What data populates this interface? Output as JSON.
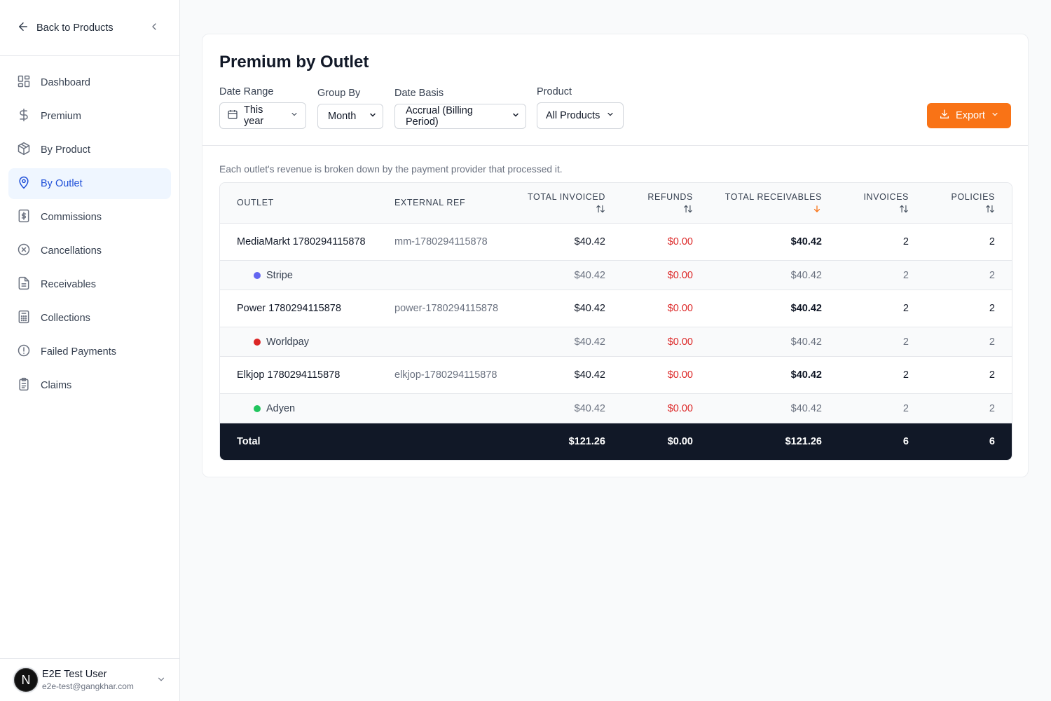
{
  "sidebar": {
    "back_label": "Back to Products",
    "items": [
      {
        "label": "Dashboard",
        "icon": "dashboard-icon",
        "active": false
      },
      {
        "label": "Premium",
        "icon": "dollar-icon",
        "active": false
      },
      {
        "label": "By Product",
        "icon": "package-icon",
        "active": false
      },
      {
        "label": "By Outlet",
        "icon": "map-pin-icon",
        "active": true
      },
      {
        "label": "Commissions",
        "icon": "receipt-dollar-icon",
        "active": false
      },
      {
        "label": "Cancellations",
        "icon": "x-circle-icon",
        "active": false
      },
      {
        "label": "Receivables",
        "icon": "document-icon",
        "active": false
      },
      {
        "label": "Collections",
        "icon": "calculator-icon",
        "active": false
      },
      {
        "label": "Failed Payments",
        "icon": "alert-circle-icon",
        "active": false
      },
      {
        "label": "Claims",
        "icon": "clipboard-icon",
        "active": false
      }
    ],
    "user": {
      "initial": "N",
      "name": "E2E Test User",
      "email": "e2e-test@gangkhar.com"
    }
  },
  "header": {
    "title": "Premium by Outlet",
    "filters": {
      "date_range": {
        "label": "Date Range",
        "value": "This year"
      },
      "group_by": {
        "label": "Group By",
        "value": "Month"
      },
      "date_basis": {
        "label": "Date Basis",
        "value": "Accrual (Billing Period)"
      },
      "product": {
        "label": "Product",
        "value": "All Products"
      }
    },
    "export_label": "Export"
  },
  "description": "Each outlet's revenue is broken down by the payment provider that processed it.",
  "table": {
    "columns": {
      "outlet": "Outlet",
      "external_ref": "External Ref",
      "total_invoiced": "Total Invoiced",
      "refunds": "Refunds",
      "total_receivables": "Total Receivables",
      "invoices": "Invoices",
      "policies": "Policies"
    },
    "sorted_column": "total_receivables",
    "rows": [
      {
        "outlet": "MediaMarkt 1780294115878",
        "ref": "mm-1780294115878",
        "invoiced": "$40.42",
        "refunds": "$0.00",
        "receivables": "$40.42",
        "invoices": "2",
        "policies": "2",
        "provider": {
          "name": "Stripe",
          "color": "#6366f1",
          "invoiced": "$40.42",
          "refunds": "$0.00",
          "receivables": "$40.42",
          "invoices": "2",
          "policies": "2"
        }
      },
      {
        "outlet": "Power 1780294115878",
        "ref": "power-1780294115878",
        "invoiced": "$40.42",
        "refunds": "$0.00",
        "receivables": "$40.42",
        "invoices": "2",
        "policies": "2",
        "provider": {
          "name": "Worldpay",
          "color": "#dc2626",
          "invoiced": "$40.42",
          "refunds": "$0.00",
          "receivables": "$40.42",
          "invoices": "2",
          "policies": "2"
        }
      },
      {
        "outlet": "Elkjop 1780294115878",
        "ref": "elkjop-1780294115878",
        "invoiced": "$40.42",
        "refunds": "$0.00",
        "receivables": "$40.42",
        "invoices": "2",
        "policies": "2",
        "provider": {
          "name": "Adyen",
          "color": "#22c55e",
          "invoiced": "$40.42",
          "refunds": "$0.00",
          "receivables": "$40.42",
          "invoices": "2",
          "policies": "2"
        }
      }
    ],
    "total": {
      "label": "Total",
      "invoiced": "$121.26",
      "refunds": "$0.00",
      "receivables": "$121.26",
      "invoices": "6",
      "policies": "6"
    }
  },
  "colors": {
    "accent": "#f97316",
    "active_nav": "#1d4ed8",
    "refund_red": "#dc2626",
    "total_bg": "#111827"
  }
}
